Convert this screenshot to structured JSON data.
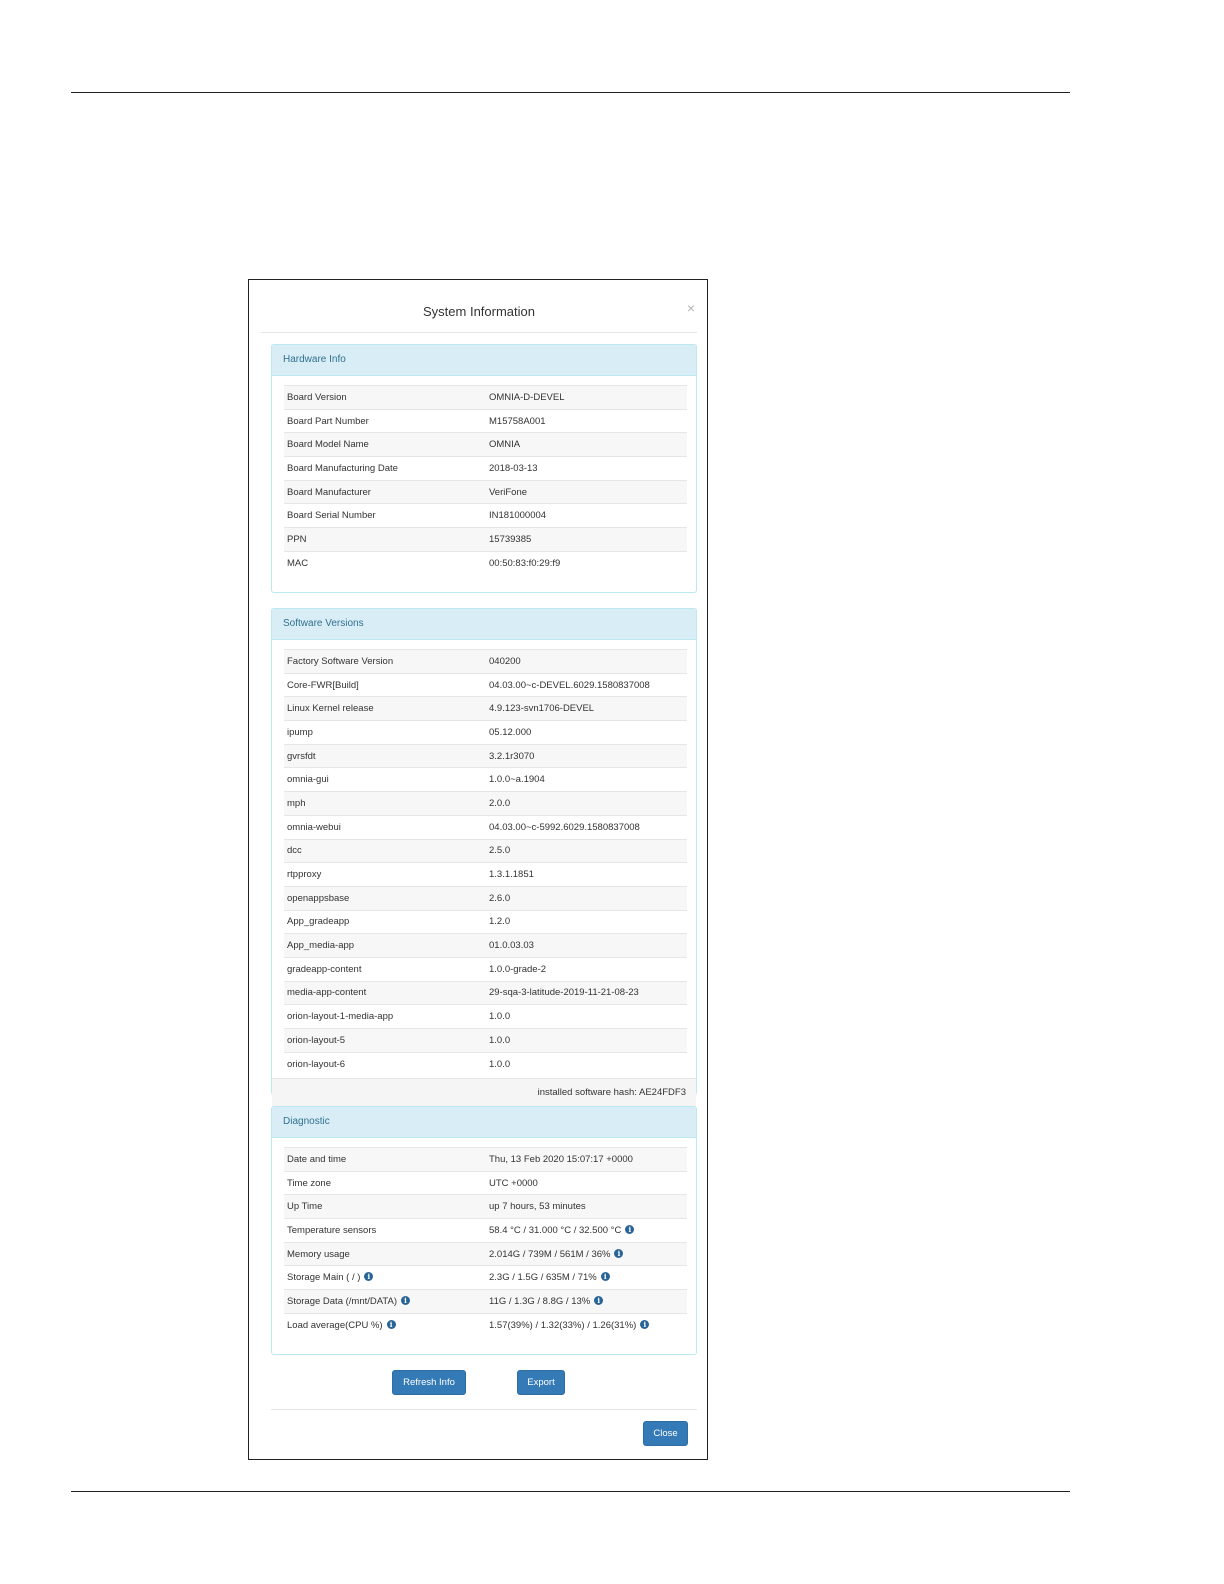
{
  "dialog": {
    "title": "System Information",
    "close_symbol": "×"
  },
  "hardware": {
    "heading": "Hardware Info",
    "rows": [
      {
        "k": "Board Version",
        "v": "OMNIA-D-DEVEL"
      },
      {
        "k": "Board Part Number",
        "v": "M15758A001"
      },
      {
        "k": "Board Model Name",
        "v": "OMNIA"
      },
      {
        "k": "Board Manufacturing Date",
        "v": "2018-03-13"
      },
      {
        "k": "Board Manufacturer",
        "v": "VeriFone"
      },
      {
        "k": "Board Serial Number",
        "v": "IN181000004"
      },
      {
        "k": "PPN",
        "v": "15739385"
      },
      {
        "k": "MAC",
        "v": "00:50:83:f0:29:f9"
      }
    ]
  },
  "software": {
    "heading": "Software Versions",
    "rows": [
      {
        "k": "Factory Software Version",
        "v": "040200"
      },
      {
        "k": "Core-FWR[Build]",
        "v": "04.03.00~c-DEVEL.6029.1580837008"
      },
      {
        "k": "Linux Kernel release",
        "v": "4.9.123-svn1706-DEVEL"
      },
      {
        "k": "ipump",
        "v": "05.12.000"
      },
      {
        "k": "gvrsfdt",
        "v": "3.2.1r3070"
      },
      {
        "k": "omnia-gui",
        "v": "1.0.0~a.1904"
      },
      {
        "k": "mph",
        "v": "2.0.0"
      },
      {
        "k": "omnia-webui",
        "v": "04.03.00~c-5992.6029.1580837008"
      },
      {
        "k": "dcc",
        "v": "2.5.0"
      },
      {
        "k": "rtpproxy",
        "v": "1.3.1.1851"
      },
      {
        "k": "openappsbase",
        "v": "2.6.0"
      },
      {
        "k": "App_gradeapp",
        "v": "1.2.0"
      },
      {
        "k": "App_media-app",
        "v": "01.0.03.03"
      },
      {
        "k": "gradeapp-content",
        "v": "1.0.0-grade-2"
      },
      {
        "k": "media-app-content",
        "v": "29-sqa-3-latitude-2019-11-21-08-23"
      },
      {
        "k": "orion-layout-1-media-app",
        "v": "1.0.0"
      },
      {
        "k": "orion-layout-5",
        "v": "1.0.0"
      },
      {
        "k": "orion-layout-6",
        "v": "1.0.0"
      }
    ],
    "hash_text": "installed software hash: AE24FDF3"
  },
  "diagnostic": {
    "heading": "Diagnostic",
    "rows": [
      {
        "k": "Date and time",
        "v": "Thu, 13 Feb 2020 15:07:17 +0000",
        "key_icon": false,
        "val_icon": false
      },
      {
        "k": "Time zone",
        "v": "UTC +0000",
        "key_icon": false,
        "val_icon": false
      },
      {
        "k": "Up Time",
        "v": "up 7 hours, 53 minutes",
        "key_icon": false,
        "val_icon": false
      },
      {
        "k": "Temperature sensors",
        "v": "58.4 °C / 31.000 °C / 32.500 °C",
        "key_icon": false,
        "val_icon": true
      },
      {
        "k": "Memory usage",
        "v": "2.014G / 739M / 561M / 36%",
        "key_icon": false,
        "val_icon": true
      },
      {
        "k": "Storage Main ( / )",
        "v": "2.3G / 1.5G / 635M / 71%",
        "key_icon": true,
        "val_icon": true
      },
      {
        "k": "Storage Data (/mnt/DATA)",
        "v": "11G / 1.3G / 8.8G / 13%",
        "key_icon": true,
        "val_icon": true
      },
      {
        "k": "Load average(CPU %)",
        "v": "1.57(39%) / 1.32(33%) / 1.26(31%)",
        "key_icon": true,
        "val_icon": true
      }
    ]
  },
  "actions": {
    "refresh_label": "Refresh Info",
    "export_label": "Export",
    "close_label": "Close"
  },
  "icons": {
    "info": "info-circle-icon",
    "close": "close-icon"
  },
  "colors": {
    "primary": "#337ab7",
    "panel_heading_bg": "#d9edf7",
    "panel_heading_text": "#31708f"
  }
}
